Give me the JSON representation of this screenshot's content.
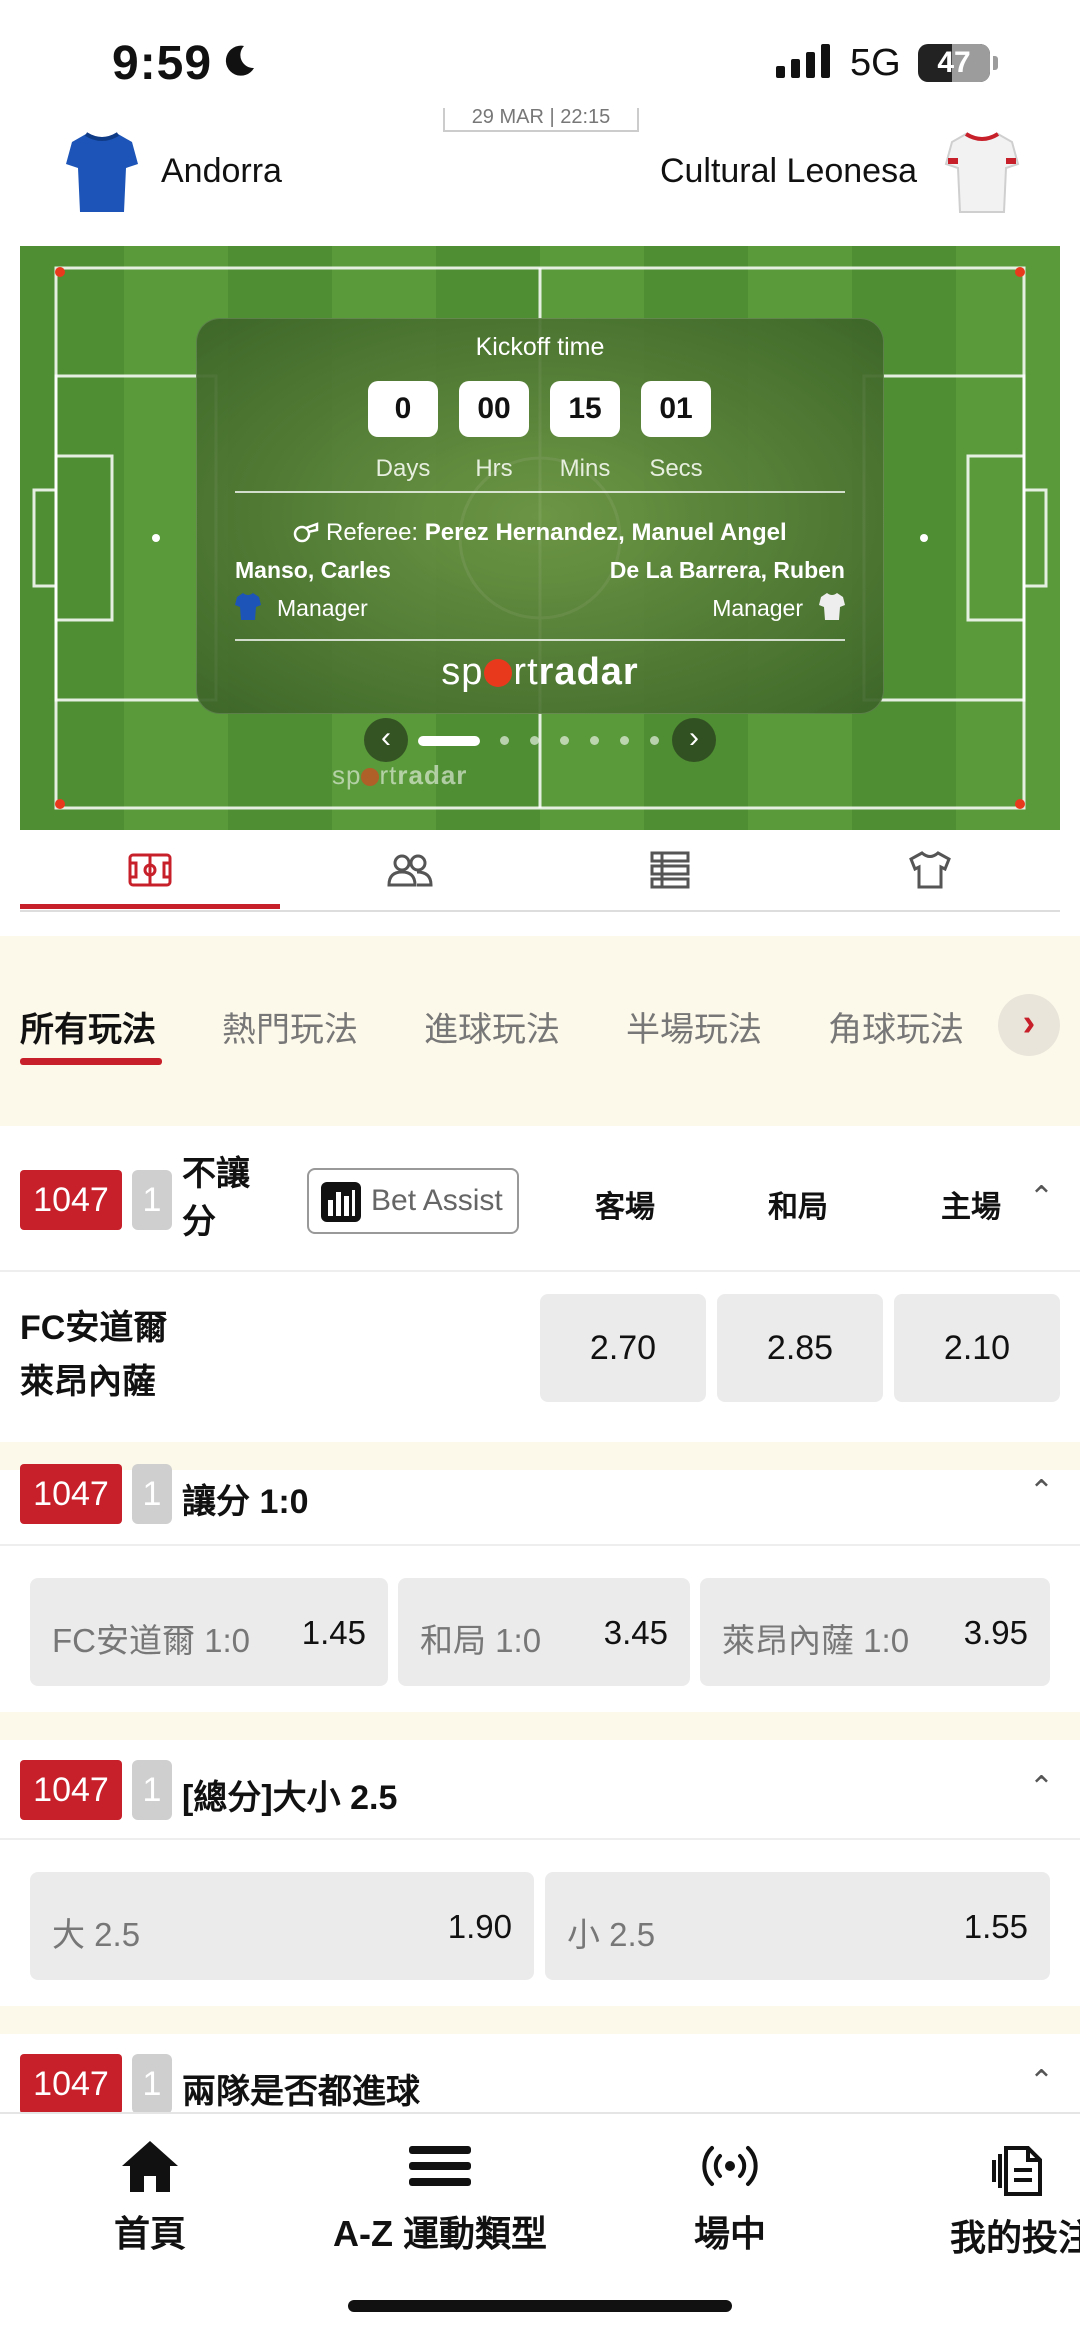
{
  "status": {
    "time": "9:59",
    "network": "5G",
    "battery": "47"
  },
  "match": {
    "date_fragment": "29 MAR | 22:15",
    "home_team": "Andorra",
    "away_team": "Cultural Leonesa",
    "kickoff_title": "Kickoff time",
    "countdown": [
      {
        "value": "0",
        "label": "Days"
      },
      {
        "value": "00",
        "label": "Hrs"
      },
      {
        "value": "15",
        "label": "Mins"
      },
      {
        "value": "01",
        "label": "Secs"
      }
    ],
    "referee_label": "Referee:",
    "referee_name": "Perez Hernandez, Manuel Angel",
    "home_manager": "Manso, Carles",
    "away_manager": "De La Barrera, Ruben",
    "manager_label": "Manager",
    "provider_logo_a": "sp",
    "provider_logo_b": "rt",
    "provider_logo_c": "radar",
    "carousel_pages": 7,
    "carousel_active": 0
  },
  "icon_tabs": [
    {
      "icon": "pitch-icon",
      "active": true
    },
    {
      "icon": "lineup-icon",
      "active": false
    },
    {
      "icon": "stats-list-icon",
      "active": false
    },
    {
      "icon": "shirt-icon",
      "active": false
    }
  ],
  "market_tabs": [
    "所有玩法",
    "熱門玩法",
    "進球玩法",
    "半場玩法",
    "角球玩法"
  ],
  "markets": {
    "m1": {
      "id": "1047",
      "sub": "1",
      "title": "不讓分",
      "bet_assist": "Bet Assist",
      "columns": [
        "客場",
        "和局",
        "主場"
      ],
      "team_home": "FC安道爾",
      "team_away": "萊昂內薩",
      "odds": [
        "2.70",
        "2.85",
        "2.10"
      ]
    },
    "m2": {
      "id": "1047",
      "sub": "1",
      "title": "讓分 1:0",
      "selections": [
        {
          "label": "FC安道爾 1:0",
          "odd": "1.45"
        },
        {
          "label": "和局 1:0",
          "odd": "3.45"
        },
        {
          "label": "萊昂內薩 1:0",
          "odd": "3.95"
        }
      ]
    },
    "m3": {
      "id": "1047",
      "sub": "1",
      "title": "[總分]大小 2.5",
      "selections": [
        {
          "label": "大 2.5",
          "odd": "1.90"
        },
        {
          "label": "小 2.5",
          "odd": "1.55"
        }
      ]
    },
    "m4": {
      "id": "1047",
      "sub": "1",
      "title": "兩隊是否都進球"
    }
  },
  "bottom_nav": [
    {
      "label": "首頁",
      "icon": "home-icon"
    },
    {
      "label": "A-Z 運動類型",
      "icon": "menu-icon"
    },
    {
      "label": "場中",
      "icon": "live-icon"
    },
    {
      "label": "我的投注",
      "icon": "bet-slip-icon"
    }
  ],
  "colors": {
    "accent": "#c8202a",
    "pitch": "#5a9a3b",
    "tab_bg": "#fdf9ea",
    "odds_bg": "#ebebeb"
  }
}
